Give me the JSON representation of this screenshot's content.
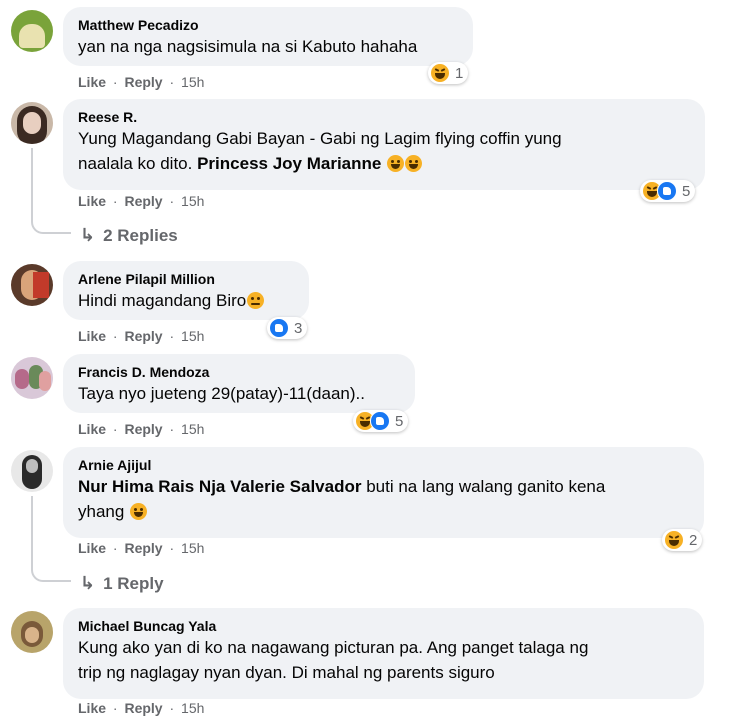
{
  "comments": [
    {
      "author": "Matthew Pecadizo",
      "text": "yan na nga nagsisimula na si Kabuto hahaha",
      "like": "Like",
      "reply": "Reply",
      "sep": "·",
      "time": "15h",
      "reaction_count": "1",
      "avatar_color": "#7aa33a"
    },
    {
      "author": "Reese R.",
      "text_line1": "Yung Magandang Gabi Bayan - Gabi ng Lagim flying coffin yung",
      "text_line2": "naalala ko dito. ",
      "mention": "Princess Joy Marianne",
      "like": "Like",
      "reply": "Reply",
      "sep": "·",
      "time": "15h",
      "reaction_count": "5",
      "replies_label": "2 Replies",
      "avatar_color": "#c9b8a8"
    },
    {
      "author": "Arlene Pilapil Million",
      "text": "Hindi magandang Biro",
      "like": "Like",
      "reply": "Reply",
      "sep": "·",
      "time": "15h",
      "reaction_count": "3",
      "avatar_color": "#5a3a2a"
    },
    {
      "author": "Francis D. Mendoza",
      "text": "Taya nyo jueteng 29(patay)-11(daan)..",
      "like": "Like",
      "reply": "Reply",
      "sep": "·",
      "time": "15h",
      "reaction_count": "5",
      "avatar_color": "#b56a8a"
    },
    {
      "author": "Arnie Ajijul",
      "mention": "Nur Hima Rais Nja Valerie Salvador",
      "text_line1": " buti na lang walang ganito kena",
      "text_line2": "yhang ",
      "like": "Like",
      "reply": "Reply",
      "sep": "·",
      "time": "15h",
      "reaction_count": "2",
      "replies_label": "1 Reply",
      "avatar_color": "#3a3a3a"
    },
    {
      "author": "Michael Buncag Yala",
      "text_line1": "Kung ako yan di ko na nagawang picturan pa. Ang panget talaga ng",
      "text_line2": "trip ng naglagay nyan dyan. Di mahal ng parents siguro",
      "like": "Like",
      "reply": "Reply",
      "sep": "·",
      "time": "15h",
      "avatar_color": "#8a7a3a"
    }
  ]
}
